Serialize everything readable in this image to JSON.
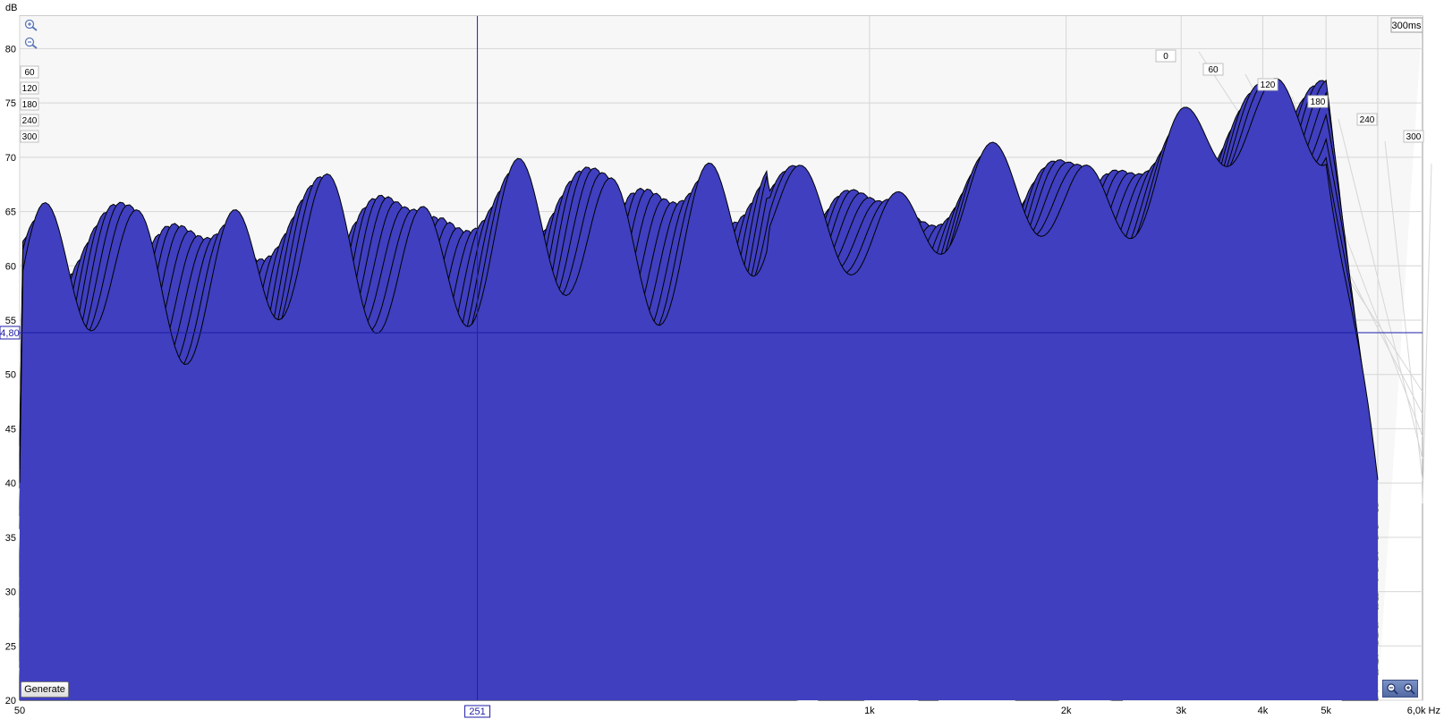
{
  "chart_data": {
    "type": "area",
    "subtype": "waterfall",
    "ylabel": "dB",
    "ylim": [
      20,
      83
    ],
    "y_ticks": [
      20,
      25,
      30,
      35,
      40,
      45,
      50,
      55,
      60,
      65,
      70,
      75,
      80
    ],
    "xlim": [
      50,
      6000
    ],
    "x_scale": "log",
    "x_tick_labels": [
      {
        "value": 50,
        "label": "50"
      },
      {
        "value": 1000,
        "label": "1k"
      },
      {
        "value": 2000,
        "label": "2k"
      },
      {
        "value": 3000,
        "label": "3k"
      },
      {
        "value": 4000,
        "label": "4k"
      },
      {
        "value": 5000,
        "label": "5k"
      },
      {
        "value": 6000,
        "label": "6,0k Hz"
      }
    ],
    "time_axis": {
      "unit": "ms",
      "range": [
        0,
        300
      ],
      "corner_label": "300ms",
      "tick_labels": [
        "0",
        "60",
        "120",
        "180",
        "240",
        "300"
      ]
    },
    "left_time_labels": [
      "60",
      "120",
      "180",
      "240",
      "300"
    ],
    "cursor": {
      "x_label": "251",
      "y_label": "4,80"
    },
    "fill_color": "#3f3fbf",
    "line_color": "#000000",
    "grid": true,
    "slice_count": 60,
    "front_slice_peaks": [
      {
        "freq": 2000,
        "db": 66
      },
      {
        "freq": 3000,
        "db": 70
      },
      {
        "freq": 4000,
        "db": 72
      },
      {
        "freq": 5000,
        "db": 75
      }
    ]
  },
  "controls": {
    "generate_label": "Generate"
  },
  "colors": {
    "background": "#ffffff",
    "floor": "#ebebeb",
    "back_wall": "#f7f7f7",
    "grid": "#d6d6d6",
    "cursor_line": "#1e1ea8"
  }
}
